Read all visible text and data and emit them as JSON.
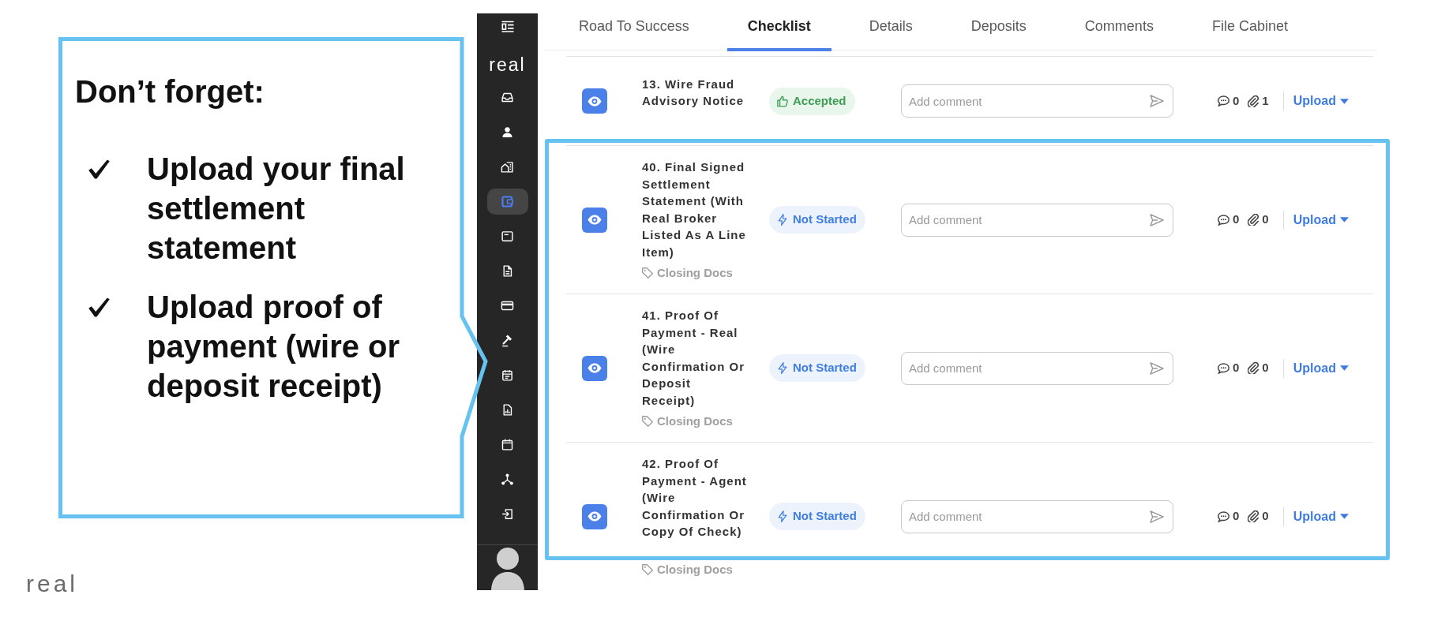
{
  "callout": {
    "heading": "Don’t forget:",
    "items": [
      "Upload your final settlement statement",
      "Upload proof of payment (wire or deposit receipt)"
    ]
  },
  "footer_logo": "real",
  "sidebar": {
    "logo": "real",
    "items": [
      {
        "selected": false
      },
      {
        "selected": false
      },
      {
        "selected": false
      },
      {
        "selected": true
      },
      {
        "selected": false
      },
      {
        "selected": false
      },
      {
        "selected": false
      },
      {
        "selected": false
      },
      {
        "selected": false
      },
      {
        "selected": false
      },
      {
        "selected": false
      },
      {
        "selected": false
      },
      {
        "selected": false
      }
    ]
  },
  "tabs": [
    {
      "label": "Road To Success",
      "selected": false
    },
    {
      "label": "Checklist",
      "selected": true
    },
    {
      "label": "Details",
      "selected": false
    },
    {
      "label": "Deposits",
      "selected": false
    },
    {
      "label": "Comments",
      "selected": false
    },
    {
      "label": "File Cabinet",
      "selected": false
    }
  ],
  "rows": [
    {
      "title": "13. Wire Fraud Advisory Notice",
      "status": {
        "kind": "accepted",
        "label": "Accepted"
      },
      "comment": {
        "placeholder": "Add comment"
      },
      "comments": "0",
      "attachments": "1",
      "action": "Upload",
      "highlighted": false
    },
    {
      "title": "40. Final Signed Settlement Statement (With Real Broker Listed As A Line Item)",
      "tag": "Closing Docs",
      "status": {
        "kind": "not_started",
        "label": "Not Started"
      },
      "comment": {
        "placeholder": "Add comment"
      },
      "comments": "0",
      "attachments": "0",
      "action": "Upload",
      "highlighted": true
    },
    {
      "title": "41. Proof Of Payment - Real (Wire Confirmation Or Deposit Receipt)",
      "tag": "Closing Docs",
      "status": {
        "kind": "not_started",
        "label": "Not Started"
      },
      "comment": {
        "placeholder": "Add comment"
      },
      "comments": "0",
      "attachments": "0",
      "action": "Upload",
      "highlighted": true
    },
    {
      "title": "42. Proof Of Payment - Agent (Wire Confirmation Or Copy Of Check)",
      "tag": "Closing Docs",
      "status": {
        "kind": "not_started",
        "label": "Not Started"
      },
      "comment": {
        "placeholder": "Add comment"
      },
      "comments": "0",
      "attachments": "0",
      "action": "Upload",
      "highlighted": true
    }
  ]
}
